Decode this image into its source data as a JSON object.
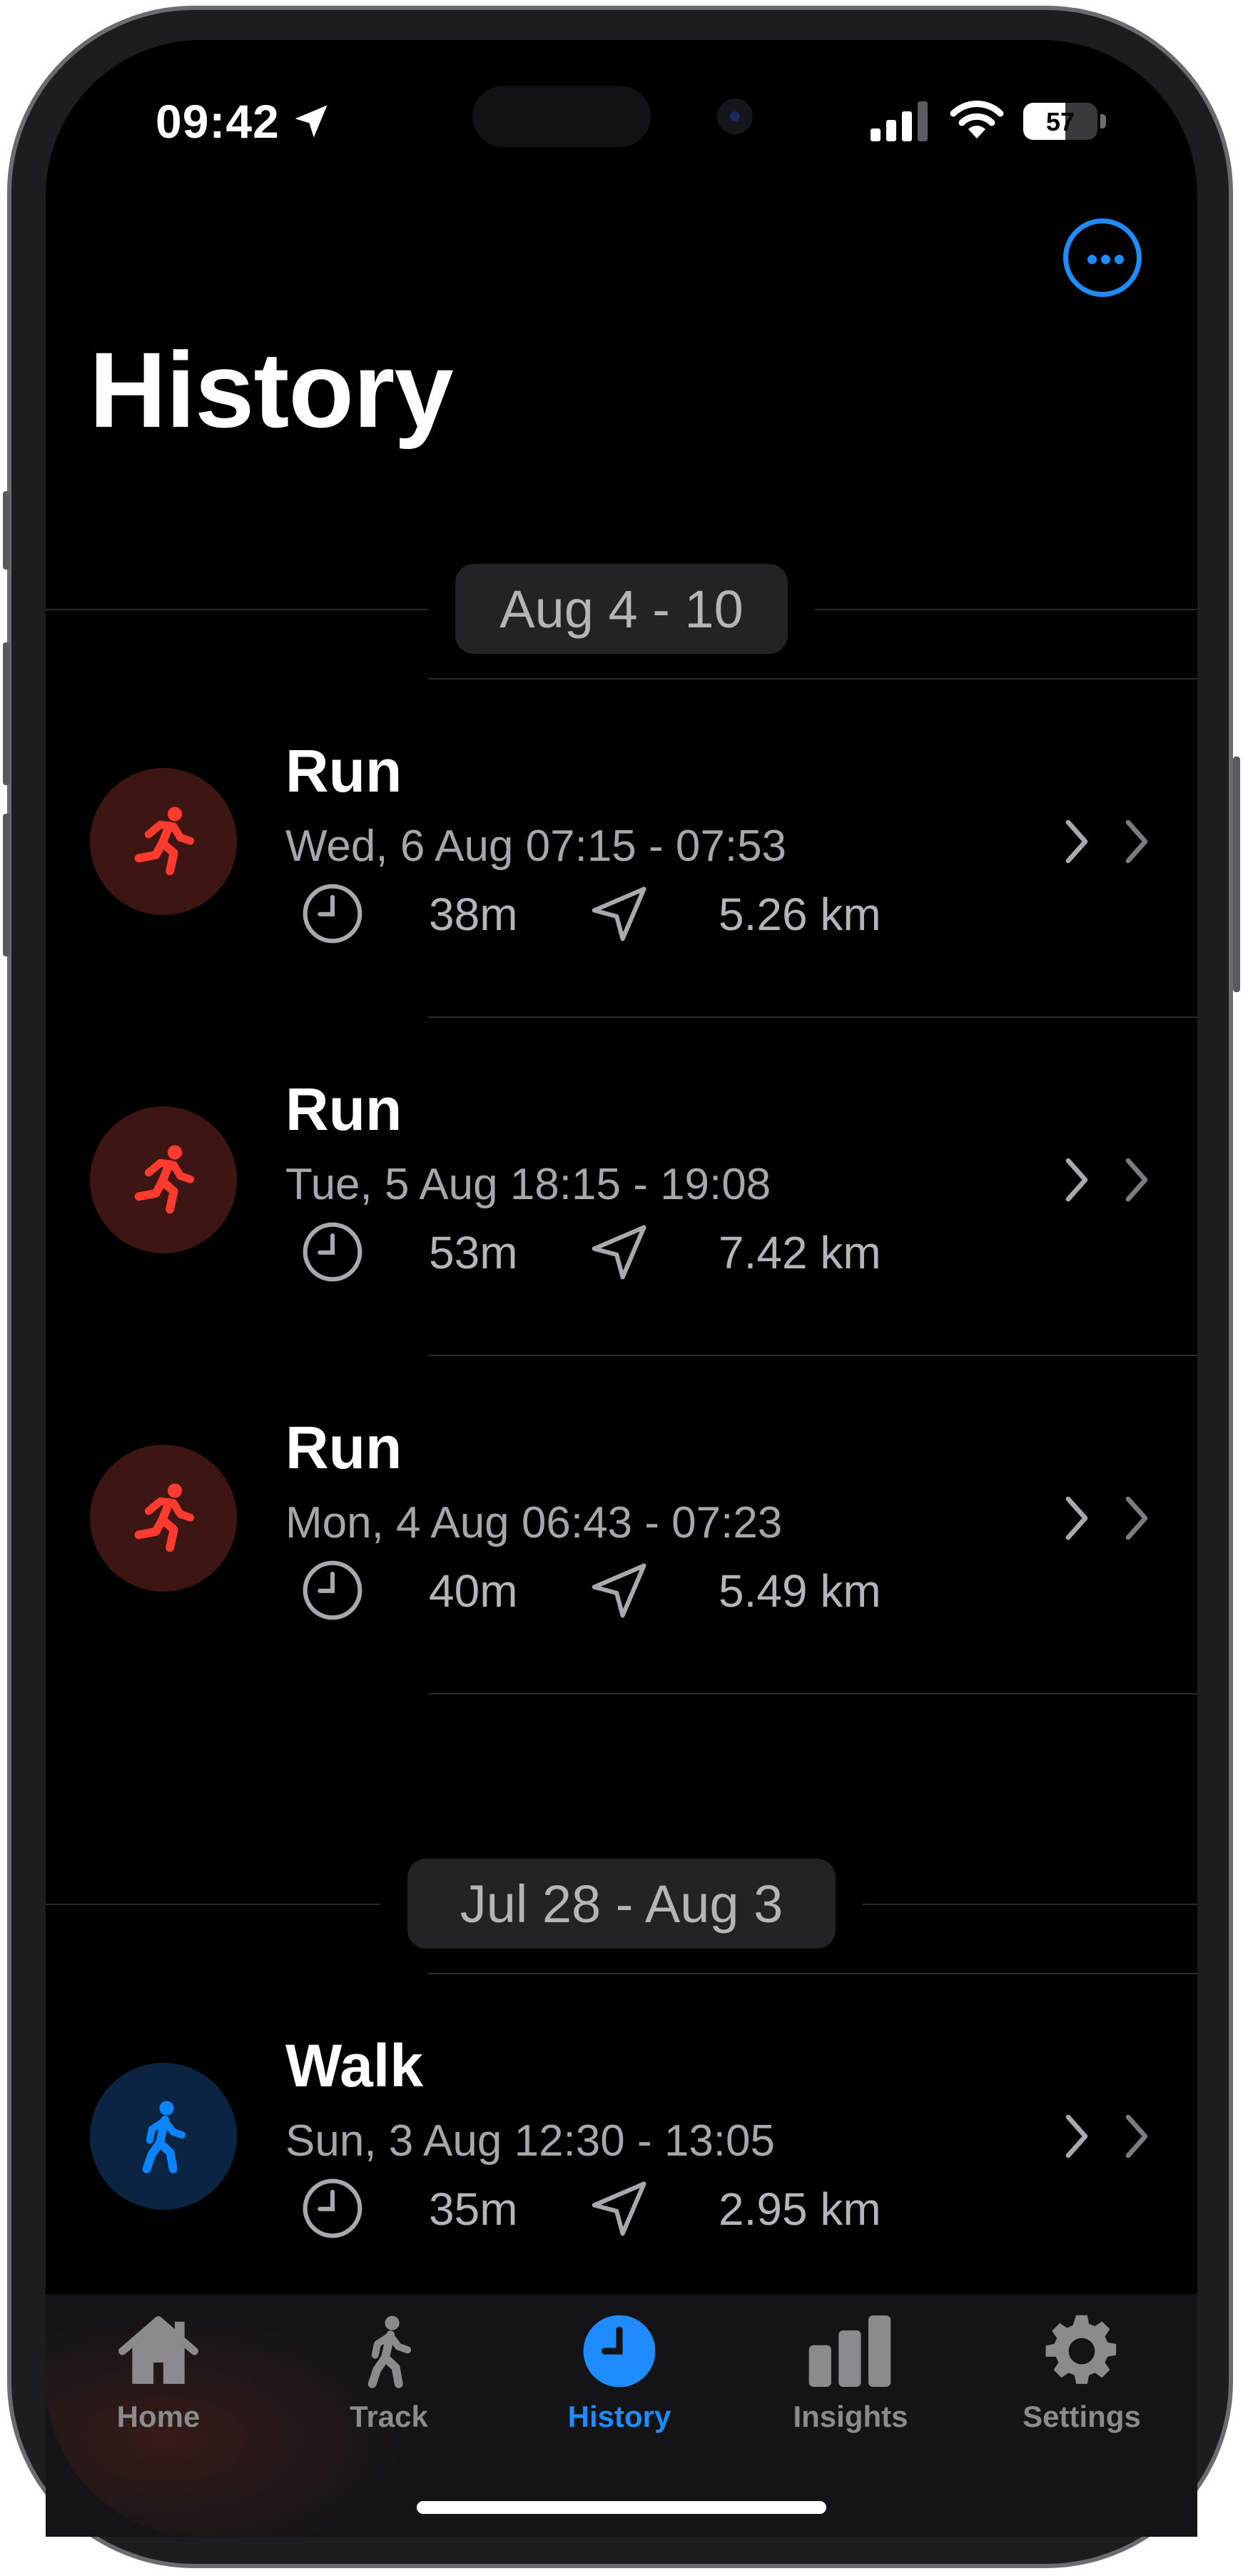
{
  "status_bar": {
    "time": "09:42",
    "battery_level": "57"
  },
  "page": {
    "title": "History"
  },
  "weeks": [
    {
      "label": "Aug 4 - 10",
      "activities": [
        {
          "type": "Run",
          "kind": "run",
          "date": "Wed, 6 Aug 07:15 - 07:53",
          "duration": "38m",
          "distance": "5.26 km"
        },
        {
          "type": "Run",
          "kind": "run",
          "date": "Tue, 5 Aug 18:15 - 19:08",
          "duration": "53m",
          "distance": "7.42 km"
        },
        {
          "type": "Run",
          "kind": "run",
          "date": "Mon, 4 Aug 06:43 - 07:23",
          "duration": "40m",
          "distance": "5.49 km"
        }
      ]
    },
    {
      "label": "Jul 28 - Aug 3",
      "activities": [
        {
          "type": "Walk",
          "kind": "walk",
          "date": "Sun, 3 Aug 12:30 - 13:05",
          "duration": "35m",
          "distance": "2.95 km"
        }
      ]
    }
  ],
  "icons": {
    "run": "running-figure-icon",
    "walk": "walking-figure-icon",
    "duration": "clock-icon",
    "distance": "location-arrow-icon",
    "row_action": "chevron-right-icon",
    "menu": "more-ellipsis-icon"
  },
  "tabs": [
    {
      "label": "Home",
      "icon": "house-icon",
      "active": false
    },
    {
      "label": "Track",
      "icon": "walking-figure-icon",
      "active": false
    },
    {
      "label": "History",
      "icon": "clock-icon",
      "active": true
    },
    {
      "label": "Insights",
      "icon": "bar-chart-icon",
      "active": false
    },
    {
      "label": "Settings",
      "icon": "gear-icon",
      "active": false
    }
  ],
  "colors": {
    "accent": "#1e8cff",
    "run": "#ff3b30",
    "run_bg": "#3d1512",
    "walk": "#0a84ff",
    "walk_bg": "#0b2442",
    "background": "#000000"
  }
}
